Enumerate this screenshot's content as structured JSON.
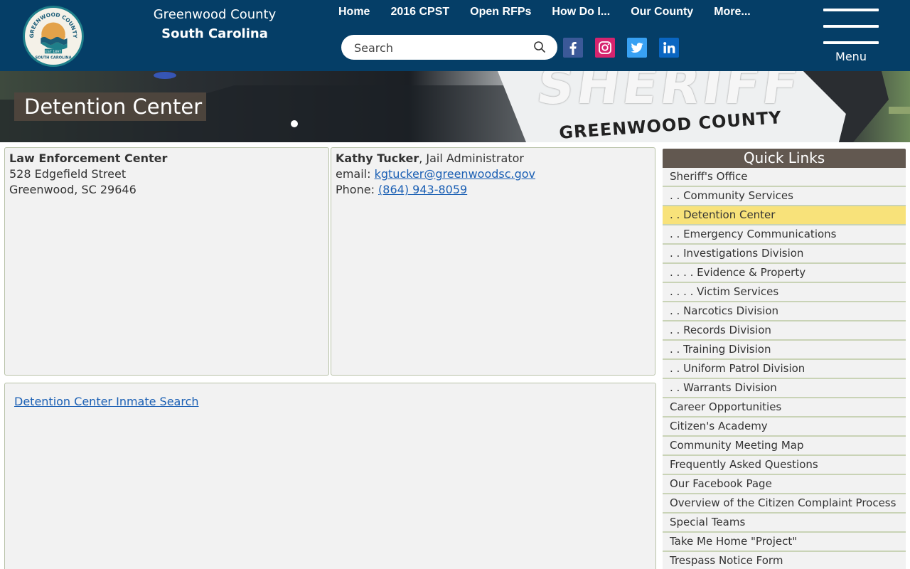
{
  "header": {
    "county_line1": "Greenwood County",
    "county_line2": "South Carolina",
    "logo_text_top": "GREENWOOD COUNTY",
    "logo_text_bottom": "SOUTH CAROLINA",
    "logo_est": "EST 1897",
    "nav": [
      "Home",
      "2016 CPST",
      "Open RFPs",
      "How Do I...",
      "Our County",
      "More..."
    ],
    "search_placeholder": "Search",
    "social": [
      "facebook-icon",
      "instagram-icon",
      "twitter-icon",
      "linkedin-icon"
    ],
    "menu_label": "Menu"
  },
  "banner": {
    "sheriff_text": "SHERIFF",
    "vehicle_text": "GREENWOOD COUNTY",
    "page_title": "Detention Center"
  },
  "panels": {
    "location": {
      "name": "Law Enforcement Center",
      "street": "528 Edgefield Street",
      "city": "Greenwood, SC 29646"
    },
    "contact": {
      "name": "Kathy Tucker",
      "role": ", Jail Administrator",
      "email_label": "email: ",
      "email": "kgtucker@greenwoodsc.gov",
      "phone_label": "Phone: ",
      "phone": "(864) 943-8059"
    },
    "search_link": "Detention Center Inmate Search"
  },
  "quick_links": {
    "title": "Quick Links",
    "active_index": 2,
    "items": [
      "Sheriff's Office",
      ". . Community Services",
      ". . Detention Center",
      ". . Emergency Communications",
      ". . Investigations Division",
      ". . . . Evidence & Property",
      ". . . . Victim Services",
      ". . Narcotics Division",
      ". . Records Division",
      ". . Training Division",
      ". . Uniform Patrol Division",
      ". . Warrants Division",
      "Career Opportunities",
      "Citizen's Academy",
      "Community Meeting Map",
      "Frequently Asked Questions",
      "Our Facebook Page",
      "Overview of the Citizen Complaint Process",
      "Special Teams",
      "Take Me Home \"Project\"",
      "Trespass Notice Form"
    ]
  },
  "colors": {
    "header_bg": "#053e67",
    "title_box": "#625850",
    "active_link": "#f8e27a",
    "link": "#1a5fb4"
  }
}
